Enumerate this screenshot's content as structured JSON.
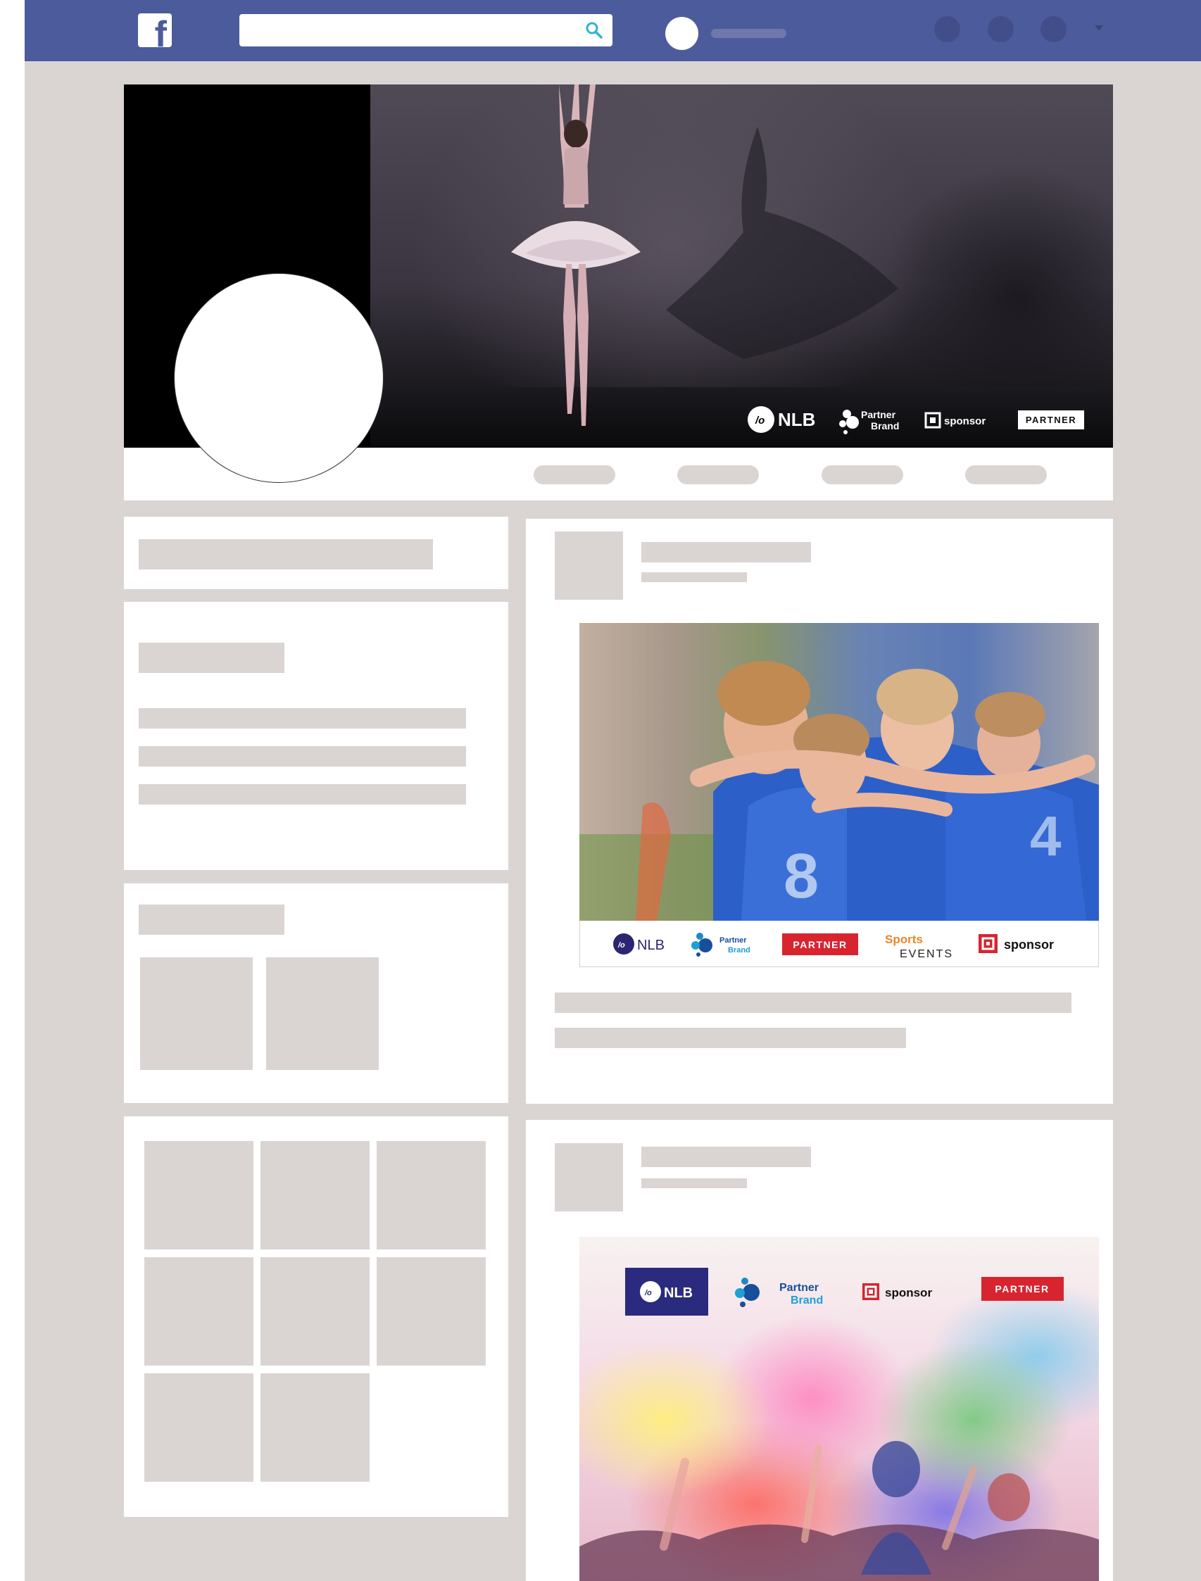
{
  "brand": {
    "accent": "#4c5b9c",
    "background": "#dad5d3",
    "placeholder": "#dad5d3"
  },
  "topbar": {
    "logo_letter": "f",
    "search": {
      "value": "",
      "placeholder": ""
    },
    "icons": [
      "facebook-logo-icon",
      "search-icon",
      "profile-avatar-icon",
      "notification-dot-icon",
      "chevron-down-icon"
    ]
  },
  "cover": {
    "sponsor_logos": [
      "NLB",
      "Partner",
      "Brand",
      "sponsor",
      "PARTNER"
    ]
  },
  "post1": {
    "sponsor_logos": [
      "NLB",
      "Partner",
      "Brand",
      "PARTNER",
      "Sports",
      "EVENTS",
      "sponsor"
    ]
  },
  "post2": {
    "sponsor_logos": [
      "NLB",
      "Partner",
      "Brand",
      "sponsor",
      "PARTNER"
    ]
  }
}
